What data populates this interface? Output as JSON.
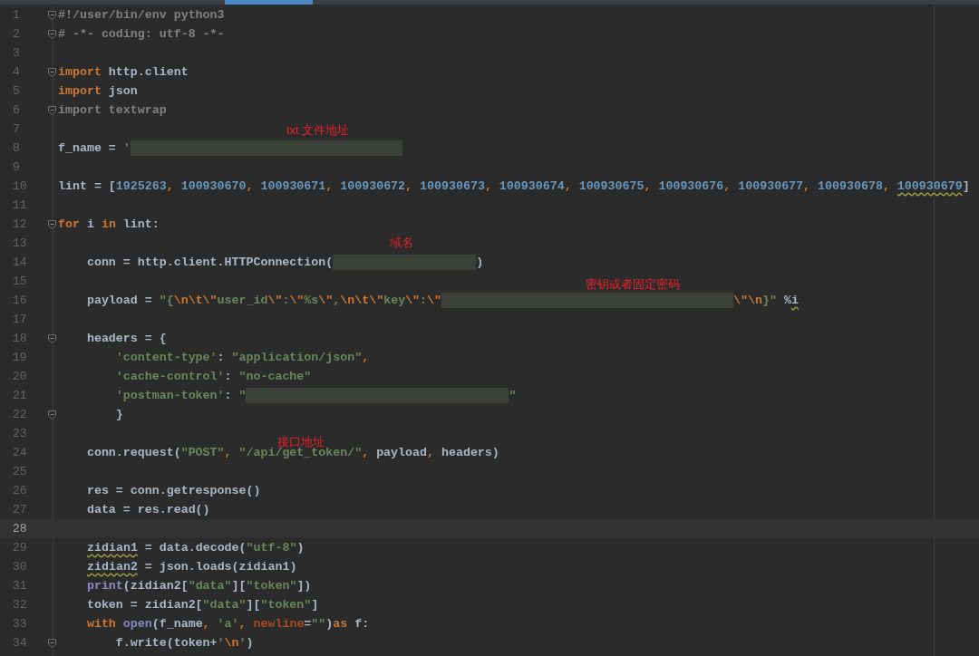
{
  "editor": {
    "tabs": [
      {
        "selected": true
      }
    ],
    "lines": [
      {
        "n": "1",
        "fold": true,
        "current": false,
        "tokens": [
          {
            "kind": "comment",
            "text": "#!/user/bin/env python3"
          }
        ]
      },
      {
        "n": "2",
        "fold": true,
        "current": false,
        "tokens": [
          {
            "kind": "comment",
            "text": "# -*- coding: utf-8 -*-"
          }
        ]
      },
      {
        "n": "3",
        "fold": false,
        "current": false
      },
      {
        "n": "4",
        "fold": true,
        "current": false,
        "tokens": [
          {
            "kind": "keyword",
            "text": "import"
          },
          {
            "kind": "plain",
            "text": " http.client"
          }
        ]
      },
      {
        "n": "5",
        "fold": false,
        "current": false,
        "tokens": [
          {
            "kind": "keyword",
            "text": "import"
          },
          {
            "kind": "plain",
            "text": " json"
          }
        ]
      },
      {
        "n": "6",
        "fold": true,
        "current": false,
        "tokens": [
          {
            "kind": "unused",
            "text": "import textwrap"
          }
        ]
      },
      {
        "n": "7",
        "fold": false,
        "current": false,
        "annotation": "txt 文件地址"
      },
      {
        "n": "8",
        "fold": false,
        "current": false,
        "tokens": [
          {
            "kind": "plain",
            "text": "f_name = "
          },
          {
            "kind": "string",
            "text": "'"
          },
          {
            "kind": "redacted"
          }
        ]
      },
      {
        "n": "9",
        "fold": false,
        "current": false
      },
      {
        "n": "10",
        "fold": false,
        "current": false,
        "tokens": [
          {
            "kind": "plain",
            "text": "lint = ["
          },
          {
            "kind": "number",
            "text": "1925263"
          },
          {
            "kind": "punct",
            "text": ", "
          },
          {
            "kind": "number",
            "text": "100930670"
          },
          {
            "kind": "punct",
            "text": ", "
          },
          {
            "kind": "number",
            "text": "100930671"
          },
          {
            "kind": "punct",
            "text": ", "
          },
          {
            "kind": "number",
            "text": "100930672"
          },
          {
            "kind": "punct",
            "text": ", "
          },
          {
            "kind": "number",
            "text": "100930673"
          },
          {
            "kind": "punct",
            "text": ", "
          },
          {
            "kind": "number",
            "text": "100930674"
          },
          {
            "kind": "punct",
            "text": ", "
          },
          {
            "kind": "number",
            "text": "100930675"
          },
          {
            "kind": "punct",
            "text": ", "
          },
          {
            "kind": "number",
            "text": "100930676"
          },
          {
            "kind": "punct",
            "text": ", "
          },
          {
            "kind": "number",
            "text": "100930677"
          },
          {
            "kind": "punct",
            "text": ", "
          },
          {
            "kind": "number",
            "text": "100930678"
          },
          {
            "kind": "punct",
            "text": ", "
          },
          {
            "kind": "number",
            "text": "100930679",
            "warning": true
          },
          {
            "kind": "plain",
            "text": "]"
          }
        ]
      },
      {
        "n": "11",
        "fold": false,
        "current": false
      },
      {
        "n": "12",
        "fold": true,
        "current": false,
        "tokens": [
          {
            "kind": "keyword",
            "text": "for"
          },
          {
            "kind": "plain",
            "text": " i "
          },
          {
            "kind": "keyword",
            "text": "in"
          },
          {
            "kind": "plain",
            "text": " lint:"
          }
        ]
      },
      {
        "n": "13",
        "fold": false,
        "current": false,
        "annotation": "域名"
      },
      {
        "n": "14",
        "fold": false,
        "current": false,
        "tokens": [
          {
            "kind": "plain",
            "text": "    conn = http.client.HTTPConnection("
          },
          {
            "kind": "redacted"
          },
          {
            "kind": "plain",
            "text": ")"
          }
        ]
      },
      {
        "n": "15",
        "fold": false,
        "current": false,
        "annotation": "密钥或者固定密码"
      },
      {
        "n": "16",
        "fold": false,
        "current": false,
        "tokens": [
          {
            "kind": "plain",
            "text": "    payload = "
          },
          {
            "kind": "string",
            "text": "\"{"
          },
          {
            "kind": "escape",
            "text": "\\n\\t\\\""
          },
          {
            "kind": "string",
            "text": "user_id"
          },
          {
            "kind": "escape",
            "text": "\\\""
          },
          {
            "kind": "string",
            "text": ":"
          },
          {
            "kind": "escape",
            "text": "\\\""
          },
          {
            "kind": "string",
            "text": "%s"
          },
          {
            "kind": "escape",
            "text": "\\\""
          },
          {
            "kind": "string",
            "text": ","
          },
          {
            "kind": "escape",
            "text": "\\n\\t\\\""
          },
          {
            "kind": "string",
            "text": "key"
          },
          {
            "kind": "escape",
            "text": "\\\""
          },
          {
            "kind": "string",
            "text": ":"
          },
          {
            "kind": "escape",
            "text": "\\\""
          },
          {
            "kind": "redacted"
          },
          {
            "kind": "escape",
            "text": "\\\"\\n"
          },
          {
            "kind": "string",
            "text": "}\""
          },
          {
            "kind": "plain",
            "text": " %"
          },
          {
            "kind": "plain",
            "text": "i",
            "warning": true
          }
        ]
      },
      {
        "n": "17",
        "fold": false,
        "current": false
      },
      {
        "n": "18",
        "fold": true,
        "current": false,
        "tokens": [
          {
            "kind": "plain",
            "text": "    headers = {"
          }
        ]
      },
      {
        "n": "19",
        "fold": false,
        "current": false,
        "tokens": [
          {
            "kind": "string",
            "text": "        'content-type'"
          },
          {
            "kind": "plain",
            "text": ": "
          },
          {
            "kind": "string",
            "text": "\"application/json\""
          },
          {
            "kind": "punct",
            "text": ","
          }
        ]
      },
      {
        "n": "20",
        "fold": false,
        "current": false,
        "tokens": [
          {
            "kind": "string",
            "text": "        'cache-control'"
          },
          {
            "kind": "plain",
            "text": ": "
          },
          {
            "kind": "string",
            "text": "\"no-cache\""
          }
        ]
      },
      {
        "n": "21",
        "fold": false,
        "current": false,
        "tokens": [
          {
            "kind": "string",
            "text": "        'postman-token'"
          },
          {
            "kind": "plain",
            "text": ": "
          },
          {
            "kind": "string",
            "text": "\""
          },
          {
            "kind": "redacted"
          },
          {
            "kind": "string",
            "text": "\""
          }
        ]
      },
      {
        "n": "22",
        "fold": true,
        "current": false,
        "tokens": [
          {
            "kind": "plain",
            "text": "        }"
          }
        ]
      },
      {
        "n": "23",
        "fold": false,
        "current": false,
        "annotation": "接口地址"
      },
      {
        "n": "24",
        "fold": false,
        "current": false,
        "tokens": [
          {
            "kind": "plain",
            "text": "    conn.request("
          },
          {
            "kind": "string",
            "text": "\"POST\""
          },
          {
            "kind": "punct",
            "text": ", "
          },
          {
            "kind": "string",
            "text": "\"/api/get_token/\""
          },
          {
            "kind": "punct",
            "text": ", "
          },
          {
            "kind": "plain",
            "text": "payload"
          },
          {
            "kind": "punct",
            "text": ", "
          },
          {
            "kind": "plain",
            "text": "headers)"
          }
        ]
      },
      {
        "n": "25",
        "fold": false,
        "current": false
      },
      {
        "n": "26",
        "fold": false,
        "current": false,
        "tokens": [
          {
            "kind": "plain",
            "text": "    res = conn.getresponse()"
          }
        ]
      },
      {
        "n": "27",
        "fold": false,
        "current": false,
        "tokens": [
          {
            "kind": "plain",
            "text": "    data = res.read()"
          }
        ]
      },
      {
        "n": "28",
        "fold": false,
        "current": true
      },
      {
        "n": "29",
        "fold": false,
        "current": false,
        "tokens": [
          {
            "kind": "indent"
          },
          {
            "kind": "plain",
            "text": "zidian1",
            "warning": true
          },
          {
            "kind": "plain",
            "text": " = data.decode("
          },
          {
            "kind": "string",
            "text": "\"utf-8\""
          },
          {
            "kind": "plain",
            "text": ")"
          }
        ]
      },
      {
        "n": "30",
        "fold": false,
        "current": false,
        "tokens": [
          {
            "kind": "indent"
          },
          {
            "kind": "plain",
            "text": "zidian2",
            "warning": true
          },
          {
            "kind": "plain",
            "text": " = json.loads(zidian1)"
          }
        ]
      },
      {
        "n": "31",
        "fold": false,
        "current": false,
        "tokens": [
          {
            "kind": "builtin",
            "text": "    print"
          },
          {
            "kind": "plain",
            "text": "(zidian2["
          },
          {
            "kind": "string",
            "text": "\"data\""
          },
          {
            "kind": "plain",
            "text": "]["
          },
          {
            "kind": "string",
            "text": "\"token\""
          },
          {
            "kind": "plain",
            "text": "])"
          }
        ]
      },
      {
        "n": "32",
        "fold": false,
        "current": false,
        "tokens": [
          {
            "kind": "plain",
            "text": "    token = zidian2["
          },
          {
            "kind": "string",
            "text": "\"data\""
          },
          {
            "kind": "plain",
            "text": "]["
          },
          {
            "kind": "string",
            "text": "\"token\""
          },
          {
            "kind": "plain",
            "text": "]"
          }
        ]
      },
      {
        "n": "33",
        "fold": false,
        "current": false,
        "tokens": [
          {
            "kind": "keyword",
            "text": "    with "
          },
          {
            "kind": "builtin",
            "text": "open"
          },
          {
            "kind": "plain",
            "text": "(f_name"
          },
          {
            "kind": "punct",
            "text": ", "
          },
          {
            "kind": "string",
            "text": "'a'"
          },
          {
            "kind": "punct",
            "text": ", "
          },
          {
            "kind": "param",
            "text": "newline"
          },
          {
            "kind": "plain",
            "text": "="
          },
          {
            "kind": "string",
            "text": "\"\""
          },
          {
            "kind": "plain",
            "text": ")"
          },
          {
            "kind": "keyword",
            "text": "as"
          },
          {
            "kind": "plain",
            "text": " f:"
          }
        ]
      },
      {
        "n": "34",
        "fold": true,
        "current": false,
        "tokens": [
          {
            "kind": "plain",
            "text": "        f.write(token+"
          },
          {
            "kind": "string",
            "text": "'"
          },
          {
            "kind": "escape",
            "text": "\\n"
          },
          {
            "kind": "string",
            "text": "'"
          },
          {
            "kind": "plain",
            "text": ")"
          }
        ]
      }
    ]
  }
}
